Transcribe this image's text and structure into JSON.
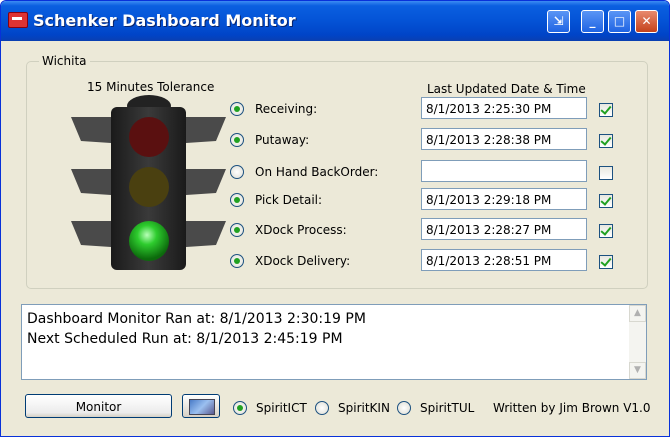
{
  "window": {
    "title": "Schenker Dashboard Monitor",
    "icon": "app-icon",
    "controls": [
      "restore-icon",
      "minimize-icon",
      "maximize-icon",
      "close-icon"
    ]
  },
  "group": {
    "title": "Wichita",
    "tolerance_label": "15 Minutes Tolerance",
    "last_updated_header": "Last Updated Date & Time",
    "traffic_light": {
      "red": false,
      "yellow": false,
      "green": true
    },
    "rows": [
      {
        "label": "Receiving:",
        "value": "8/1/2013 2:25:30 PM",
        "radio_checked": true,
        "ok": true
      },
      {
        "label": "Putaway:",
        "value": "8/1/2013 2:28:38 PM",
        "radio_checked": true,
        "ok": true
      },
      {
        "label": "On Hand BackOrder:",
        "value": "",
        "radio_checked": false,
        "ok": false
      },
      {
        "label": "Pick Detail:",
        "value": "8/1/2013 2:29:18 PM",
        "radio_checked": true,
        "ok": true
      },
      {
        "label": "XDock Process:",
        "value": "8/1/2013 2:28:27 PM",
        "radio_checked": true,
        "ok": true
      },
      {
        "label": "XDock Delivery:",
        "value": "8/1/2013 2:28:51 PM",
        "radio_checked": true,
        "ok": true
      }
    ]
  },
  "log": {
    "lines": [
      "Dashboard Monitor Ran at: 8/1/2013 2:30:19 PM",
      "Next Scheduled Run at: 8/1/2013 2:45:19 PM"
    ]
  },
  "footer": {
    "monitor_button": "Monitor",
    "sites": [
      {
        "label": "SpiritICT",
        "checked": true
      },
      {
        "label": "SpiritKIN",
        "checked": false
      },
      {
        "label": "SpiritTUL",
        "checked": false
      }
    ],
    "credit": "Written by Jim Brown V1.0"
  },
  "colors": {
    "titlebar": "#0453d6",
    "face": "#ece9d8",
    "light_on_green": "#2ecc2e",
    "light_off_red": "#5a1010",
    "light_off_yellow": "#4a4010"
  }
}
